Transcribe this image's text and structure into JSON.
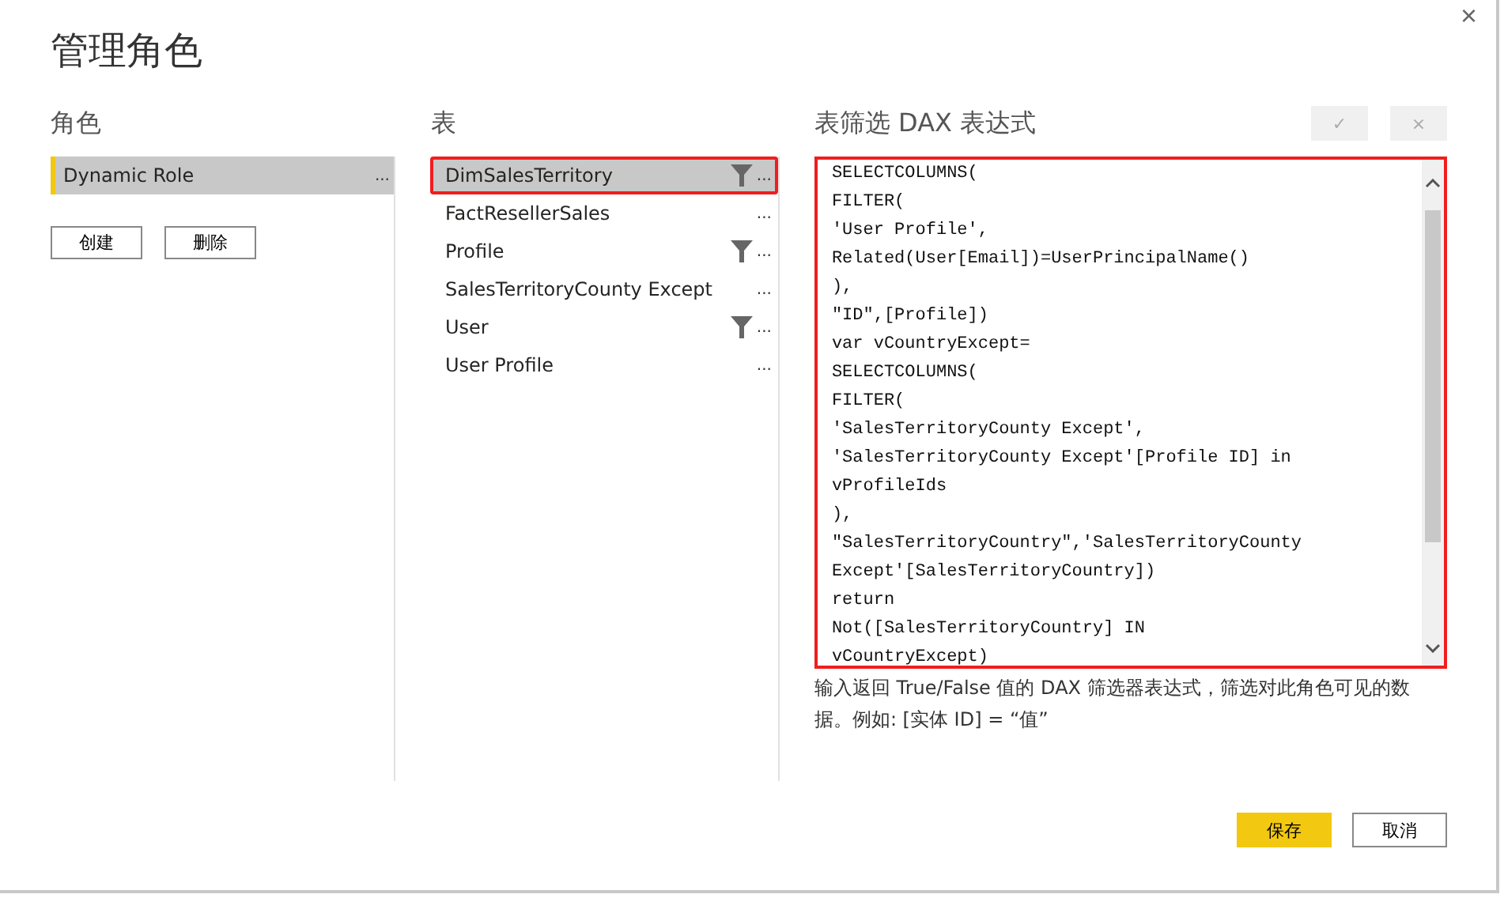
{
  "dialog": {
    "title": "管理角色",
    "close": "×"
  },
  "roles": {
    "heading": "角色",
    "items": [
      {
        "name": "Dynamic Role",
        "selected": true,
        "menu": "..."
      }
    ],
    "buttons": [
      "创建",
      "删除"
    ]
  },
  "tables": {
    "heading": "表",
    "items": [
      {
        "name": "DimSalesTerritory",
        "selected": true,
        "highlighted": true,
        "filter": true,
        "menu": "..."
      },
      {
        "name": "FactResellerSales",
        "selected": false,
        "highlighted": false,
        "filter": false,
        "menu": "..."
      },
      {
        "name": "Profile",
        "selected": false,
        "highlighted": false,
        "filter": true,
        "menu": "..."
      },
      {
        "name": "SalesTerritoryCounty Except",
        "selected": false,
        "highlighted": false,
        "filter": false,
        "menu": "..."
      },
      {
        "name": "User",
        "selected": false,
        "highlighted": false,
        "filter": true,
        "menu": "..."
      },
      {
        "name": "User Profile",
        "selected": false,
        "highlighted": false,
        "filter": false,
        "menu": "..."
      }
    ]
  },
  "dax": {
    "heading": "表筛选 DAX 表达式",
    "confirm": "✓",
    "cancel": "×",
    "highlighted": true,
    "code": [
      "SELECTCOLUMNS(",
      "FILTER(",
      "'User Profile',",
      "Related(User[Email])=UserPrincipalName()",
      "),",
      "\"ID\",[Profile])",
      "var vCountryExcept=",
      "SELECTCOLUMNS(",
      "FILTER(",
      "'SalesTerritoryCounty Except',",
      "'SalesTerritoryCounty Except'[Profile ID] in",
      "vProfileIds",
      "),",
      "\"SalesTerritoryCountry\",'SalesTerritoryCounty",
      "Except'[SalesTerritoryCountry])",
      "return",
      "Not([SalesTerritoryCountry] IN",
      "vCountryExcept)"
    ],
    "hint": "输入返回 True/False 值的 DAX 筛选器表达式，筛选对此角色可见的数据。例如: [实体 ID] = “值”"
  },
  "footer": {
    "save": "保存",
    "cancel": "取消"
  }
}
